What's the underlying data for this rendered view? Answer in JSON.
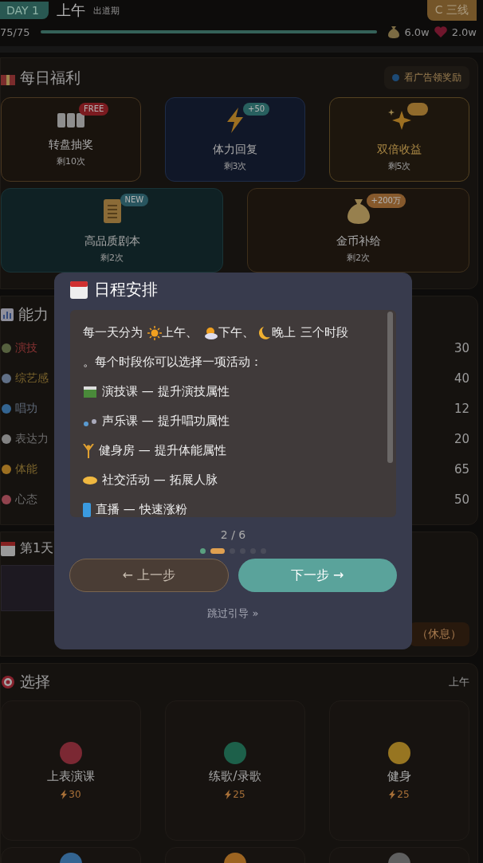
{
  "header": {
    "day": "DAY 1",
    "period": "上午",
    "stage": "出道期",
    "tier": "C 三线",
    "stamina": {
      "text": "75/75",
      "level": 1
    },
    "money": "6.0w",
    "fans": "2.0w"
  },
  "welfare": {
    "title": "每日福利",
    "ad_button": "看广告领奖励",
    "cards": [
      {
        "kind": "slot",
        "title": "转盘抽奖",
        "sub": "剩10次",
        "badge": "FREE"
      },
      {
        "kind": "energy",
        "title": "体力回复",
        "sub": "剩3次",
        "badge": "+50"
      },
      {
        "kind": "double",
        "title": "双倍收益",
        "sub": "剩5次"
      },
      {
        "kind": "script",
        "title": "高品质剧本",
        "sub": "剩2次",
        "badge": "NEW"
      },
      {
        "kind": "coins",
        "title": "金币补给",
        "sub": "剩2次",
        "badge": "+200万"
      }
    ]
  },
  "abilities": {
    "title": "能力",
    "stats": [
      {
        "kind": "acting",
        "name": "演技",
        "value": "30"
      },
      {
        "kind": "variety",
        "name": "综艺感",
        "value": "40"
      },
      {
        "kind": "singing",
        "name": "唱功",
        "value": "12"
      },
      {
        "kind": "speech",
        "name": "表达力",
        "value": "20"
      },
      {
        "kind": "fitness",
        "name": "体能",
        "value": "65"
      },
      {
        "kind": "mood",
        "name": "心态",
        "value": "50"
      }
    ]
  },
  "schedule": {
    "title": "第1天",
    "rest": "（休息）"
  },
  "activities": {
    "title": "选择",
    "period": "上午",
    "items": [
      {
        "kind": "drama",
        "name": "上表演课",
        "cost": "30"
      },
      {
        "kind": "music",
        "name": "练歌/录歌",
        "cost": "25"
      },
      {
        "kind": "gym",
        "name": "健身",
        "cost": "25"
      }
    ]
  },
  "guide": {
    "title": "日程安排",
    "intro": {
      "lead": "每一天分为",
      "periods": [
        {
          "kind": "morning",
          "label": "上午、"
        },
        {
          "kind": "afternoon",
          "label": "下午、"
        },
        {
          "kind": "night",
          "label": "晚上"
        }
      ],
      "tail": "三个时段",
      "second": "。每个时段你可以选择一项活动："
    },
    "lines": [
      {
        "kind": "clapper",
        "text": "演技课 — 提升演技属性"
      },
      {
        "kind": "notes",
        "text": "声乐课 — 提升唱功属性"
      },
      {
        "kind": "lifter",
        "text": "健身房 — 提升体能属性"
      },
      {
        "kind": "handshake",
        "text": "社交活动 — 拓展人脉"
      },
      {
        "kind": "phone",
        "text": "直播 — 快速涨粉"
      }
    ],
    "page": "2 / 6",
    "dots": [
      {
        "done": true,
        "selected": false
      },
      {
        "done": false,
        "selected": true
      },
      {
        "done": false,
        "selected": false
      },
      {
        "done": false,
        "selected": false
      },
      {
        "done": false,
        "selected": false
      },
      {
        "done": false,
        "selected": false
      }
    ],
    "prev": "← 上一步",
    "next": "下一步 →",
    "skip": "跳过引导 »"
  }
}
